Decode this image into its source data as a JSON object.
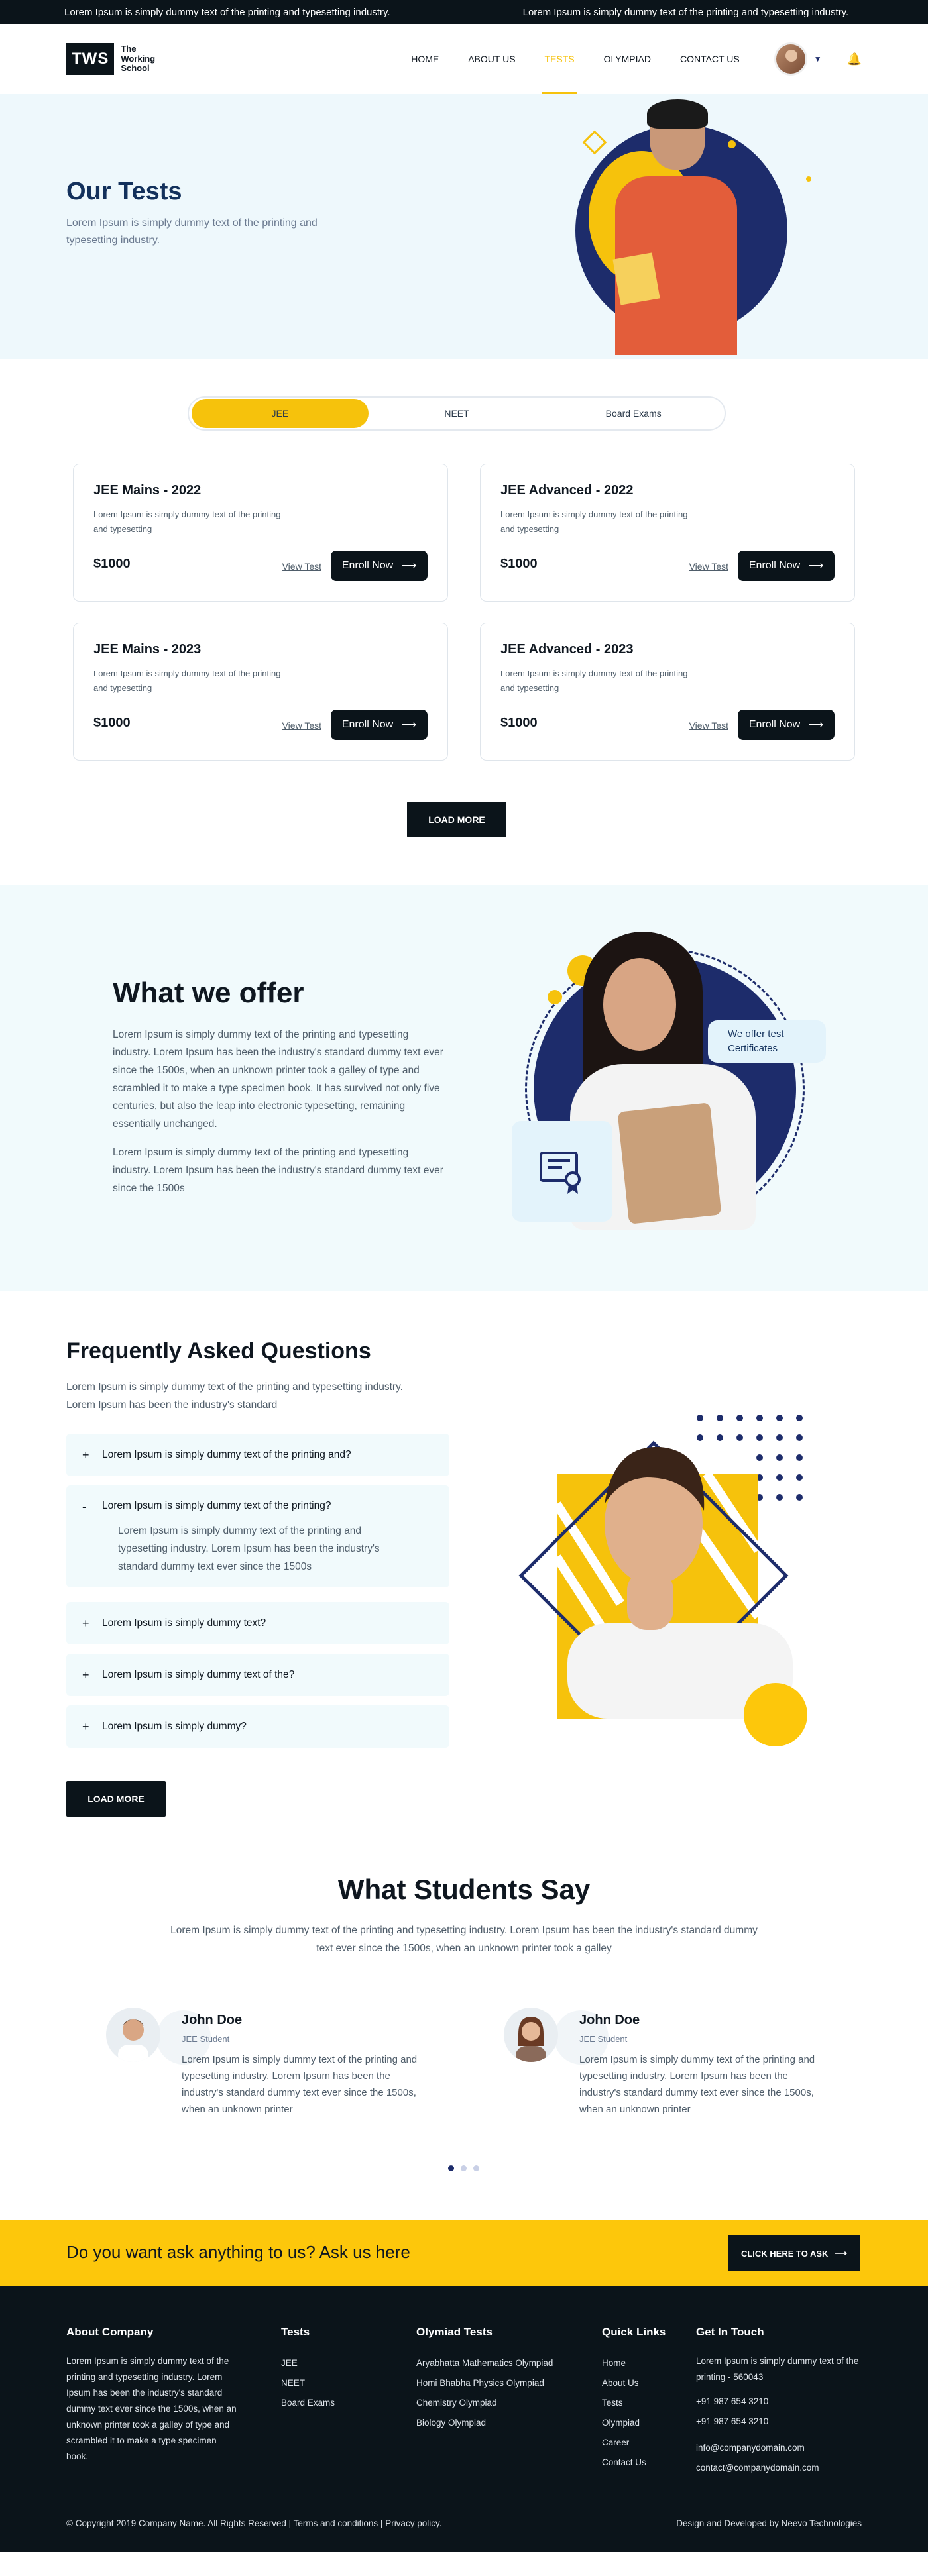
{
  "ticker": {
    "items": [
      "Lorem Ipsum is simply dummy text of the printing and typesetting industry.",
      "Lorem Ipsum is simply dummy text of the printing and typesetting industry."
    ]
  },
  "logo": {
    "mark": "TWS",
    "name": "The Working School"
  },
  "nav": {
    "items": [
      "HOME",
      "ABOUT US",
      "TESTS",
      "OLYMPIAD",
      "CONTACT US"
    ],
    "active": "TESTS"
  },
  "hero": {
    "title": "Our Tests",
    "subtitle": "Lorem Ipsum is simply dummy text of the printing and typesetting industry."
  },
  "tabs": [
    "JEE",
    "NEET",
    "Board Exams"
  ],
  "cards": [
    {
      "title": "JEE Mains - 2022",
      "desc": "Lorem Ipsum is simply dummy text of the printing and typesetting",
      "price": "$1000",
      "view": "View Test",
      "enroll": "Enroll Now"
    },
    {
      "title": "JEE Advanced - 2022",
      "desc": "Lorem Ipsum is simply dummy text of the printing and typesetting",
      "price": "$1000",
      "view": "View Test",
      "enroll": "Enroll Now"
    },
    {
      "title": "JEE Mains - 2023",
      "desc": "Lorem Ipsum is simply dummy text of the printing and typesetting",
      "price": "$1000",
      "view": "View Test",
      "enroll": "Enroll Now"
    },
    {
      "title": "JEE Advanced - 2023",
      "desc": "Lorem Ipsum is simply dummy text of the printing and typesetting",
      "price": "$1000",
      "view": "View Test",
      "enroll": "Enroll Now"
    }
  ],
  "load_more": "LOAD MORE",
  "offer": {
    "title": "What we offer",
    "p1": "Lorem Ipsum is simply dummy text of the printing and typesetting industry. Lorem Ipsum has been the industry's standard dummy text ever since the 1500s, when an unknown printer took a galley of type and scrambled it to make a type specimen book. It has survived not only five centuries, but also the leap into electronic typesetting, remaining essentially unchanged.",
    "p2": "Lorem Ipsum is simply dummy text of the printing and typesetting industry. Lorem Ipsum has been the industry's standard dummy text ever since the 1500s",
    "bubble": "We offer test Certificates"
  },
  "faq": {
    "title": "Frequently Asked Questions",
    "desc": "Lorem Ipsum is simply dummy text of the printing and typesetting industry. Lorem Ipsum has been the industry's standard",
    "items": [
      {
        "sign": "+",
        "q": "Lorem Ipsum is simply dummy text of the printing and?"
      },
      {
        "sign": "-",
        "q": "Lorem Ipsum is simply dummy text of the printing?",
        "a": "Lorem Ipsum is simply dummy text of the printing and typesetting industry. Lorem Ipsum has been the industry's standard dummy text ever since the 1500s"
      },
      {
        "sign": "+",
        "q": "Lorem Ipsum is simply dummy text?"
      },
      {
        "sign": "+",
        "q": "Lorem Ipsum is simply dummy text of the?"
      },
      {
        "sign": "+",
        "q": "Lorem Ipsum is simply dummy?"
      }
    ],
    "load_more": "LOAD MORE"
  },
  "students": {
    "title": "What Students Say",
    "desc": "Lorem Ipsum is simply dummy text of the printing and typesetting industry. Lorem Ipsum has been the industry's standard dummy text ever since the 1500s, when an unknown printer took a galley",
    "items": [
      {
        "name": "John Doe",
        "role": "JEE Student",
        "text": "Lorem Ipsum is simply dummy text of the printing and typesetting industry. Lorem Ipsum has been the industry's standard dummy text ever since the 1500s, when an unknown printer"
      },
      {
        "name": "John Doe",
        "role": "JEE Student",
        "text": "Lorem Ipsum is simply dummy text of the printing and typesetting industry. Lorem Ipsum has been the industry's standard dummy text ever since the 1500s, when an unknown printer"
      }
    ]
  },
  "ask": {
    "text": "Do you want ask anything to us? Ask us here",
    "button": "CLICK HERE TO ASK"
  },
  "footer": {
    "about": {
      "title": "About Company",
      "text": "Lorem Ipsum is simply dummy text of the printing and typesetting industry. Lorem Ipsum has been the industry's standard dummy text ever since the 1500s, when an unknown printer took a galley of type and scrambled it to make a type specimen book."
    },
    "tests": {
      "title": "Tests",
      "items": [
        "JEE",
        "NEET",
        "Board Exams"
      ]
    },
    "olympiad": {
      "title": "Olymiad Tests",
      "items": [
        "Aryabhatta Mathematics Olympiad",
        "Homi Bhabha Physics Olympiad",
        "Chemistry Olympiad",
        "Biology Olympiad"
      ]
    },
    "quick": {
      "title": "Quick Links",
      "items": [
        "Home",
        "About Us",
        "Tests",
        "Olympiad",
        "Career",
        "Contact Us"
      ]
    },
    "contact": {
      "title": "Get In Touch",
      "address": "Lorem Ipsum is simply dummy text of the printing - 560043",
      "phones": [
        "+91 987 654 3210",
        "+91 987 654 3210"
      ],
      "emails": [
        "info@companydomain.com",
        "contact@companydomain.com"
      ]
    },
    "copyright": "© Copyright 2019 Company Name. All Rights Reserved | Terms and conditions | Privacy policy.",
    "designed": "Design and Developed by Neevo Technologies"
  }
}
